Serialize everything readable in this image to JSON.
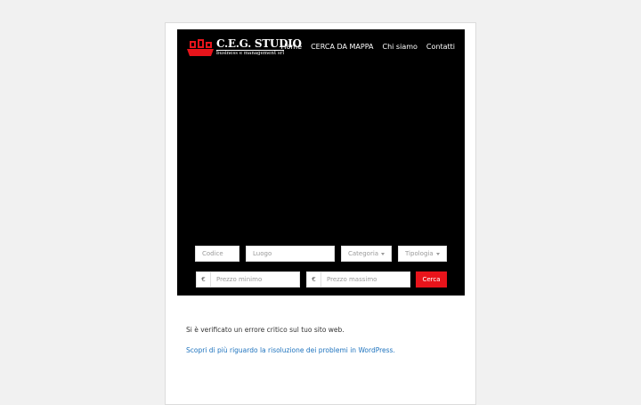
{
  "logo": {
    "title": "C.E.G. STUDIO",
    "subtitle": "business e management srl",
    "icon": "ceg-logo-icon",
    "brand_color": "#e8141b"
  },
  "nav": {
    "items": [
      {
        "label": "Home"
      },
      {
        "label": "CERCA DA MAPPA"
      },
      {
        "label": "Chi siamo"
      },
      {
        "label": "Contatti"
      }
    ]
  },
  "search": {
    "codice_placeholder": "Codice",
    "luogo_placeholder": "Luogo",
    "categoria_label": "Categoria",
    "tipologia_label": "Tipologia",
    "currency_symbol": "€",
    "prezzo_minimo_placeholder": "Prezzo minimo",
    "prezzo_massimo_placeholder": "Prezzo massimo",
    "submit_label": "Cerca"
  },
  "message": {
    "error_text": "Si è verificato un errore critico sul tuo sito web.",
    "help_link": "Scopri di più riguardo la risoluzione dei problemi in WordPress."
  },
  "colors": {
    "hero_bg": "#000000",
    "accent": "#e8141b",
    "link": "#1e73be"
  }
}
